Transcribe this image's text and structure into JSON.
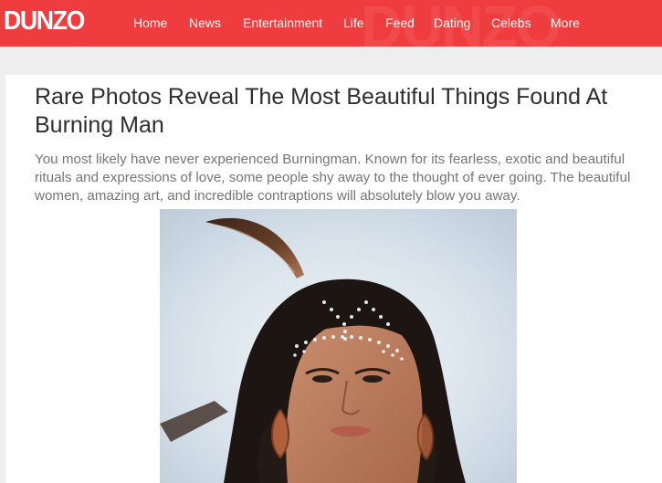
{
  "header": {
    "logo": "DUNZO",
    "watermark": "DUNZO",
    "brand_color": "#ef3d3f",
    "nav": [
      {
        "label": "Home"
      },
      {
        "label": "News"
      },
      {
        "label": "Entertainment"
      },
      {
        "label": "Life"
      },
      {
        "label": "Feed"
      },
      {
        "label": "Dating"
      },
      {
        "label": "Celebs"
      },
      {
        "label": "More"
      }
    ]
  },
  "article": {
    "title": "Rare Photos Reveal The Most Beautiful Things Found At Burning Man",
    "intro": "You most likely have never experienced Burningman. Known for its fearless, exotic and beautiful rituals and expressions of love, some people shy away to the thought of ever going. The beautiful women, amazing art, and incredible contraptions will absolutely blow you away.",
    "hero_image": "portrait-photo-feather-face-jewels"
  }
}
